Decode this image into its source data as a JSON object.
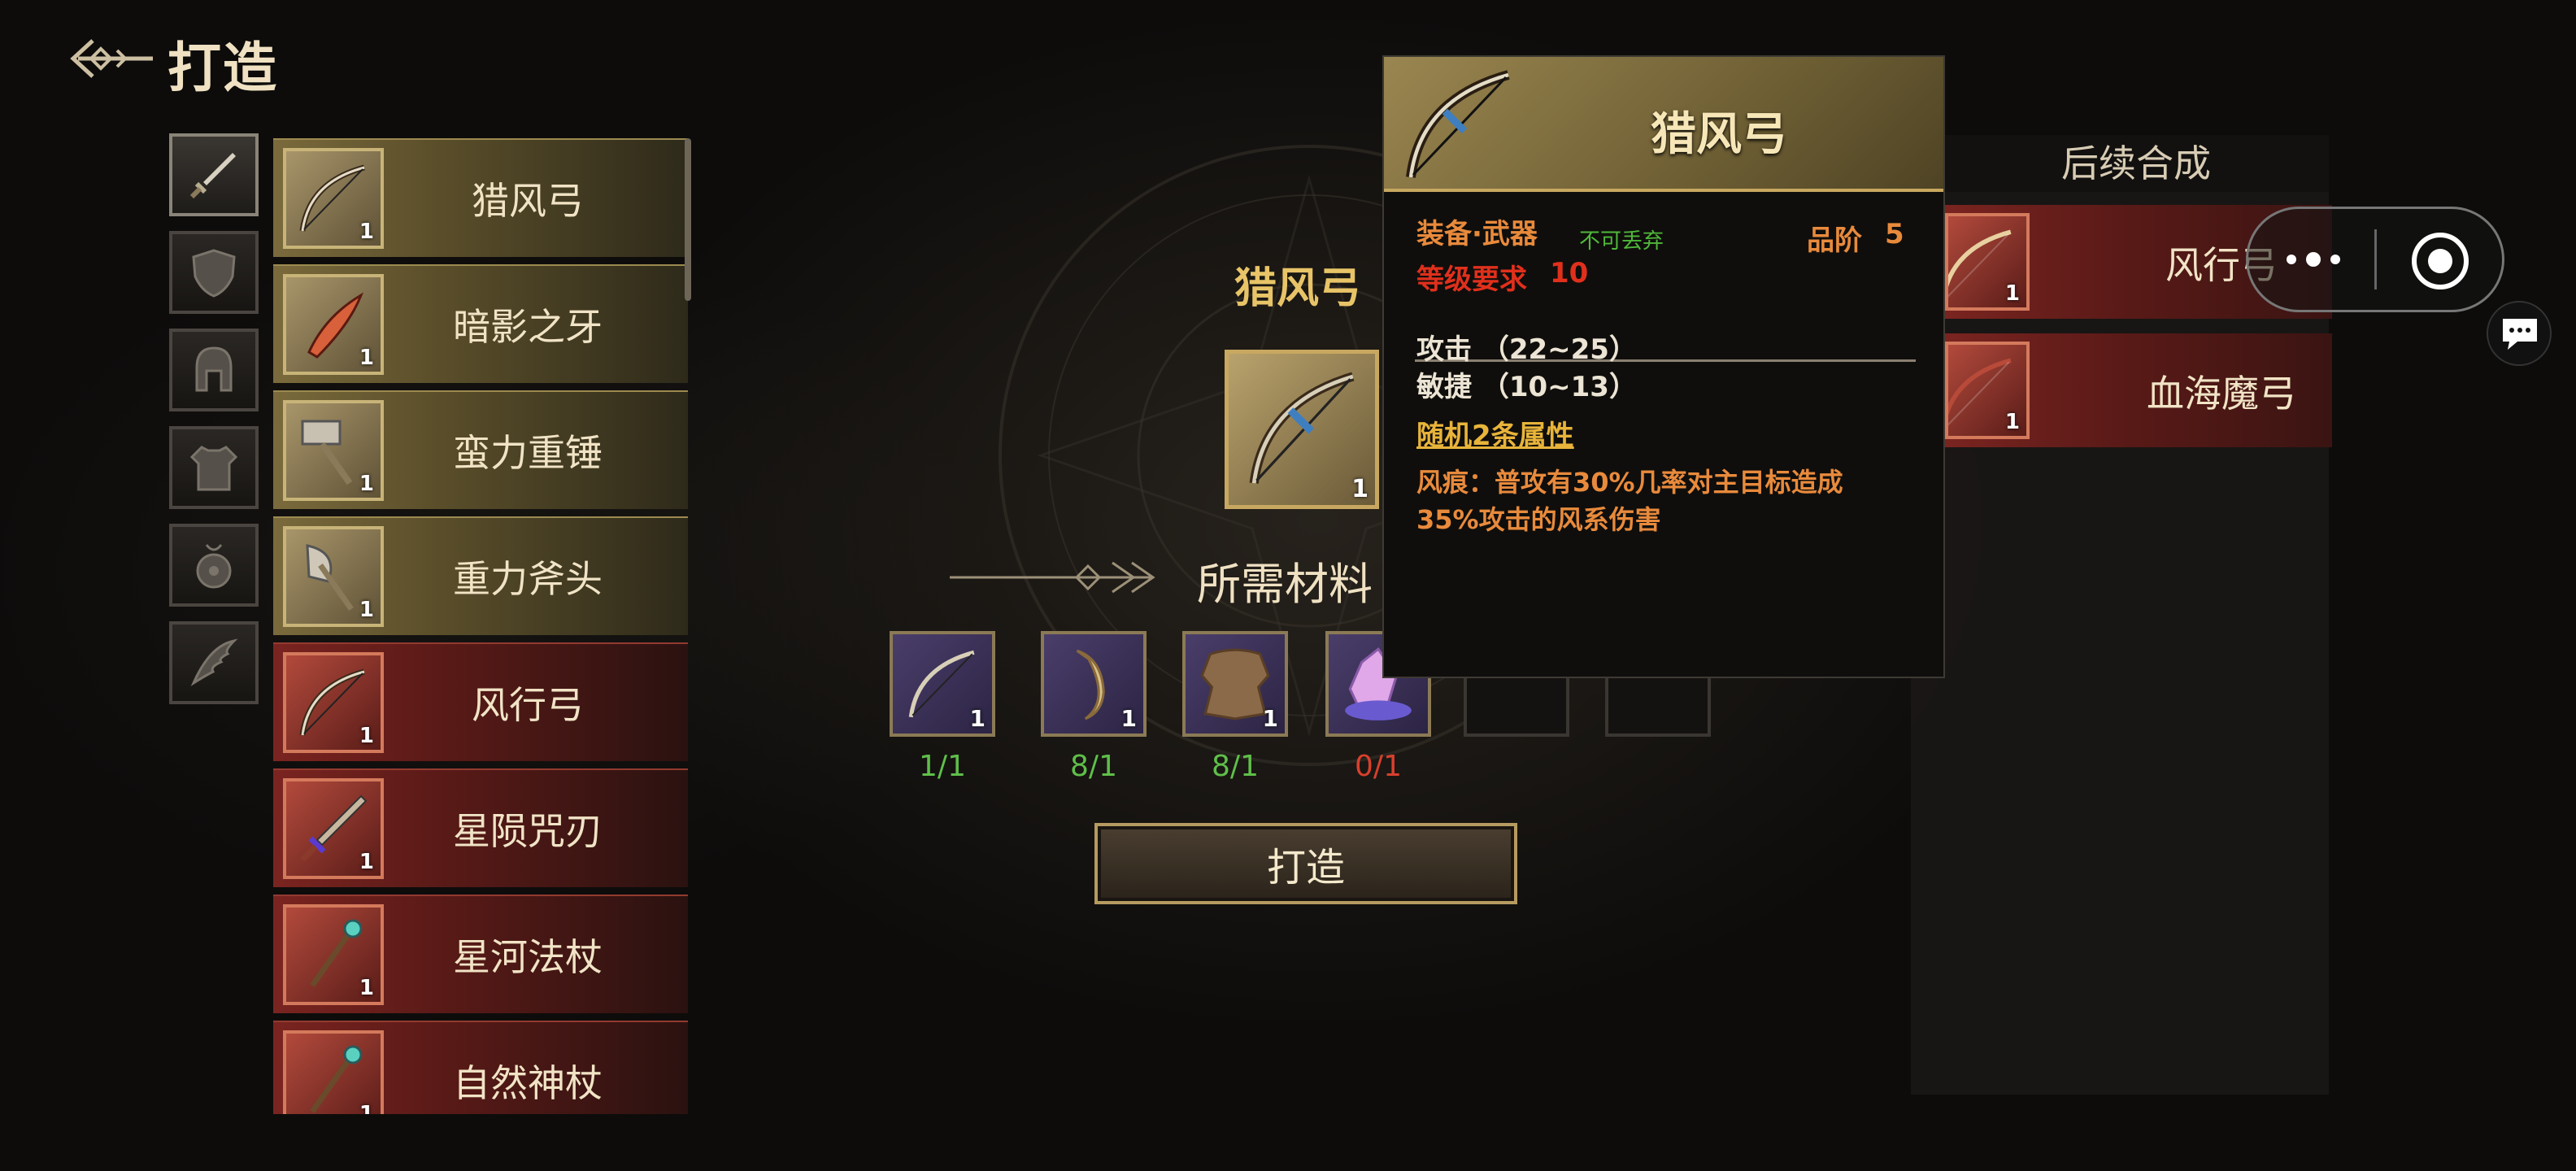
{
  "header": {
    "title": "打造",
    "back_icon": "back-arrow-icon"
  },
  "categories": [
    {
      "icon": "sword-icon",
      "active": true
    },
    {
      "icon": "shield-icon",
      "active": false
    },
    {
      "icon": "helmet-icon",
      "active": false
    },
    {
      "icon": "armor-icon",
      "active": false
    },
    {
      "icon": "amulet-icon",
      "active": false
    },
    {
      "icon": "wing-icon",
      "active": false
    }
  ],
  "recipes": [
    {
      "name": "猎风弓",
      "qty": "1",
      "rarity": "gold",
      "icon": "bow-icon"
    },
    {
      "name": "暗影之牙",
      "qty": "1",
      "rarity": "gold",
      "icon": "dagger-icon"
    },
    {
      "name": "蛮力重锤",
      "qty": "1",
      "rarity": "gold",
      "icon": "hammer-icon"
    },
    {
      "name": "重力斧头",
      "qty": "1",
      "rarity": "gold",
      "icon": "axe-icon"
    },
    {
      "name": "风行弓",
      "qty": "1",
      "rarity": "red",
      "icon": "bow-icon"
    },
    {
      "name": "星陨咒刃",
      "qty": "1",
      "rarity": "red",
      "icon": "blade-icon"
    },
    {
      "name": "星河法杖",
      "qty": "1",
      "rarity": "red",
      "icon": "staff-icon"
    },
    {
      "name": "自然神杖",
      "qty": "1",
      "rarity": "red",
      "icon": "staff-icon"
    }
  ],
  "craft": {
    "item_name": "猎风弓",
    "item_qty": "1",
    "materials_title": "所需材料",
    "materials": [
      {
        "icon": "bow-icon",
        "qty": "1",
        "count": "1/1",
        "count_color": "#5fbf4a"
      },
      {
        "icon": "horn-icon",
        "qty": "1",
        "count": "8/1",
        "count_color": "#5fbf4a"
      },
      {
        "icon": "hide-icon",
        "qty": "1",
        "count": "8/1",
        "count_color": "#5fbf4a"
      },
      {
        "icon": "crystal-icon",
        "qty": "",
        "count": "0/1",
        "count_color": "#d8402c"
      }
    ],
    "button_label": "打造"
  },
  "tooltip": {
    "title": "猎风弓",
    "type": "装备·武器",
    "no_drop": "不可丢弃",
    "grade_label": "品阶",
    "grade": "5",
    "level_label": "等级要求",
    "level": "10",
    "stats": [
      "攻击 （22~25）",
      "敏捷 （10~13）"
    ],
    "random_attr": "随机2条属性",
    "skill_line1": "风痕：普攻有30%几率对主目标造成",
    "skill_line2": "35%攻击的风系伤害"
  },
  "next": {
    "header": "后续合成",
    "items": [
      {
        "name": "风行弓",
        "qty": "1",
        "icon": "bow-icon"
      },
      {
        "name": "血海魔弓",
        "qty": "1",
        "icon": "bow-icon"
      }
    ]
  },
  "colors": {
    "accent_gold": "#e8c468",
    "ok_green": "#5fbf4a",
    "fail_red": "#d8402c",
    "rare_red": "#7a2420",
    "rare_gold": "#7a6a3c"
  }
}
